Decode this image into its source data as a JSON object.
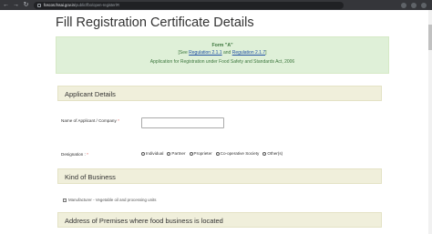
{
  "browser": {
    "url_host": "foscos.fssai.gov.in",
    "url_path": "/public/fbo/open-register/R"
  },
  "page": {
    "title": "Fill Registration Certificate Details"
  },
  "banner": {
    "heading": "Form \"A\"",
    "see_prefix": "[See",
    "regulation_1": "Regulation 2.1.1",
    "and_text": "and",
    "regulation_2": "Regulation 2.1.7",
    "see_suffix": "]",
    "application_text": "Application for Registration under Food Safety and Standards Act, 2006"
  },
  "applicant": {
    "section_title": "Applicant Details",
    "name_label": "Name of Applicant / Company",
    "name_value": "",
    "designation_label": "Designation :",
    "required_mark": "*",
    "designation_options": [
      "Individual",
      "Partner",
      "Proprieter",
      "Co-operative Society",
      "Other(s)"
    ]
  },
  "business": {
    "section_title": "Kind of Business",
    "item_label": "Manufacturer - Vegetable oil and processing units"
  },
  "address": {
    "section_title": "Address of Premises where food business is located"
  }
}
